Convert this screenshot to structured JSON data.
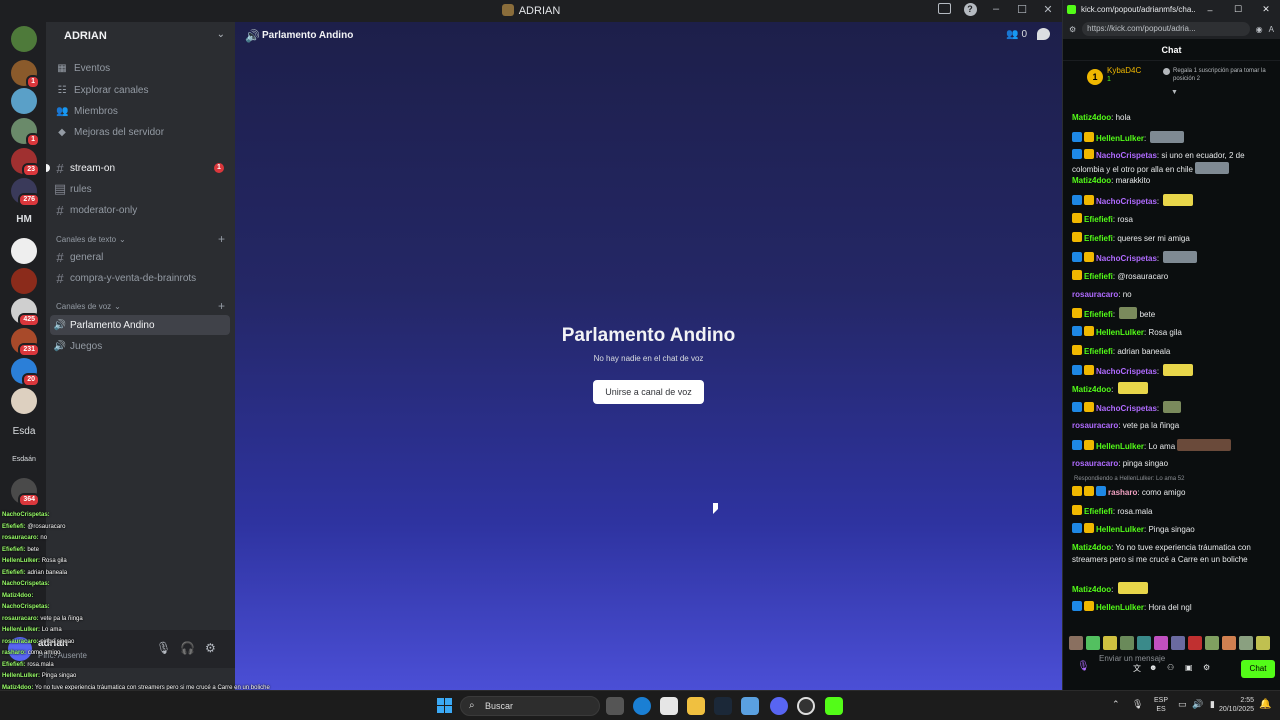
{
  "discord": {
    "window_title": "ADRIAN",
    "server_name": "ADRIAN",
    "server_menu": [
      {
        "icon": "calendar-icon",
        "label": "Eventos"
      },
      {
        "icon": "compass-icon",
        "label": "Explorar canales"
      },
      {
        "icon": "members-icon",
        "label": "Miembros"
      },
      {
        "icon": "boost-icon",
        "label": "Mejoras del servidor"
      }
    ],
    "channels_top": [
      {
        "label": "stream-on",
        "badge": "1"
      },
      {
        "label": "rules"
      },
      {
        "label": "moderator-only"
      }
    ],
    "text_category": "Canales de texto",
    "text_channels": [
      "general",
      "compra-y-venta-de-brainrots"
    ],
    "voice_category": "Canales de voz",
    "voice_channels": [
      "Parlamento Andino",
      "Juegos"
    ],
    "server_badges": [
      "1",
      "1",
      "23",
      "276",
      "425",
      "231",
      "20",
      "364"
    ],
    "server_labels": {
      "hm": "HM",
      "esda": "Esda",
      "esdaan": "Esdaán"
    },
    "user": {
      "name": "adrian",
      "status": "Pinc. Ausente"
    },
    "main": {
      "header_title": "Parlamento Andino",
      "member_count": "0",
      "vc_title": "Parlamento Andino",
      "vc_subtitle": "No hay nadie en el chat de voz",
      "join_button": "Unirse a canal de voz"
    }
  },
  "overlay_chat": [
    {
      "user": "NachoCrispetas:",
      "text": ""
    },
    {
      "user": "Efiefiefi:",
      "text": "@rosauracaro"
    },
    {
      "user": "rosauracaro:",
      "text": "no"
    },
    {
      "user": "Efiefiefi:",
      "text": "bete"
    },
    {
      "user": "HellenLulker:",
      "text": "Rosa gila"
    },
    {
      "user": "Efiefiefi:",
      "text": "adrian baneala"
    },
    {
      "user": "NachoCrispetas:",
      "text": ""
    },
    {
      "user": "Matiz4doo:",
      "text": ""
    },
    {
      "user": "NachoCrispetas:",
      "text": ""
    },
    {
      "user": "rosauracaro:",
      "text": "vete pa la ñinga"
    },
    {
      "user": "HellenLulker:",
      "text": "Lo ama"
    },
    {
      "user": "rosauracaro:",
      "text": "pinga singao"
    },
    {
      "user": "rasharo:",
      "text": "como amigo"
    },
    {
      "user": "Efiefiefi:",
      "text": "rosa.mala"
    },
    {
      "user": "HellenLulker:",
      "text": "Pinga singao"
    },
    {
      "user": "Matiz4doo:",
      "text": "Yo no tuve experiencia tráumatica con streamers pero si me crucé a Carre en un boliche"
    },
    {
      "user": "Matiz4doo:",
      "text": ""
    },
    {
      "user": "HellenLulker:",
      "text": "Hora del ngl"
    }
  ],
  "kick": {
    "tab_title": "kick.com/popout/adrianmfs/cha...",
    "url": "https://kick.com/popout/adria...",
    "chat_header": "Chat",
    "pinned": {
      "user": "KybaD4C",
      "count": "1",
      "note": "Regala 1 suscripción para tomar la posición 2"
    },
    "messages": [
      {
        "badges": [],
        "user": "Matiz4doo",
        "color": "#53fc18",
        "text": "hola",
        "emote": ""
      },
      {
        "badges": [
          "blue",
          "gold"
        ],
        "user": "HellenLulker",
        "color": "#53fc18",
        "text": "",
        "emote": "rock"
      },
      {
        "badges": [
          "blue",
          "gold"
        ],
        "user": "NachoCrispetas",
        "color": "#b06bff",
        "text": "si uno en ecuador, 2 de colombia y el otro por alla en chile",
        "emote": "rock"
      },
      {
        "badges": [],
        "user": "Matiz4doo",
        "color": "#53fc18",
        "text": "marakkito",
        "emote": ""
      },
      {
        "badges": [
          "blue",
          "gold"
        ],
        "user": "NachoCrispetas",
        "color": "#b06bff",
        "text": "",
        "emote": "wide"
      },
      {
        "badges": [
          "gold"
        ],
        "user": "Efiefiefi",
        "color": "#53fc18",
        "text": "rosa",
        "emote": ""
      },
      {
        "badges": [
          "gold"
        ],
        "user": "Efiefiefi",
        "color": "#53fc18",
        "text": "queres ser mi amiga",
        "emote": ""
      },
      {
        "badges": [
          "blue",
          "gold"
        ],
        "user": "NachoCrispetas",
        "color": "#b06bff",
        "text": "",
        "emote": "rock"
      },
      {
        "badges": [
          "gold"
        ],
        "user": "Efiefiefi",
        "color": "#53fc18",
        "text": "@rosauracaro",
        "emote": ""
      },
      {
        "badges": [],
        "user": "rosauracaro",
        "color": "#b06bff",
        "text": "no",
        "emote": ""
      },
      {
        "badges": [
          "gold"
        ],
        "user": "Efiefiefi",
        "color": "#53fc18",
        "text": "bete",
        "emote": "plain"
      },
      {
        "badges": [
          "blue",
          "gold"
        ],
        "user": "HellenLulker",
        "color": "#53fc18",
        "text": "Rosa gila",
        "emote": ""
      },
      {
        "badges": [
          "gold"
        ],
        "user": "Efiefiefi",
        "color": "#53fc18",
        "text": "adrian baneala",
        "emote": ""
      },
      {
        "badges": [
          "blue",
          "gold"
        ],
        "user": "NachoCrispetas",
        "color": "#b06bff",
        "text": "",
        "emote": "wide"
      },
      {
        "badges": [],
        "user": "Matiz4doo",
        "color": "#53fc18",
        "text": "",
        "emote": "wide"
      },
      {
        "badges": [
          "blue",
          "gold"
        ],
        "user": "NachoCrispetas",
        "color": "#b06bff",
        "text": "",
        "emote": "plain"
      },
      {
        "badges": [],
        "user": "rosauracaro",
        "color": "#b06bff",
        "text": "vete pa la ñinga",
        "emote": ""
      },
      {
        "badges": [
          "blue",
          "gold"
        ],
        "user": "HellenLulker",
        "color": "#53fc18",
        "text": "Lo ama",
        "emote": "face"
      },
      {
        "badges": [],
        "user": "rosauracaro",
        "color": "#b06bff",
        "text": "pinga singao",
        "emote": ""
      },
      {
        "badges": [
          "gold",
          "gold",
          "blue"
        ],
        "user": "rasharo",
        "color": "#f0a0c0",
        "text": "como amigo",
        "emote": ""
      },
      {
        "badges": [
          "gold"
        ],
        "user": "Efiefiefi",
        "color": "#53fc18",
        "text": "rosa.mala",
        "emote": ""
      },
      {
        "badges": [
          "blue",
          "gold"
        ],
        "user": "HellenLulker",
        "color": "#53fc18",
        "text": "Pinga singao",
        "emote": ""
      },
      {
        "badges": [],
        "user": "Matiz4doo",
        "color": "#53fc18",
        "text": "Yo no tuve experiencia tráumatica con streamers pero si me crucé a Carre en un boliche",
        "emote": ""
      },
      {
        "badges": [],
        "user": "Matiz4doo",
        "color": "#53fc18",
        "text": "",
        "emote": "wide"
      },
      {
        "badges": [
          "blue",
          "gold"
        ],
        "user": "HellenLulker",
        "color": "#53fc18",
        "text": "Hora del ngl",
        "emote": ""
      }
    ],
    "reply_context": "Respondiendo a HellenLulker: Lo ama 52",
    "input_placeholder": "Enviar un mensaje",
    "chat_button": "Chat"
  },
  "taskbar": {
    "search_placeholder": "Buscar",
    "lang_top": "ESP",
    "lang_bottom": "ES",
    "time": "2:55",
    "date": "20/10/2025"
  },
  "colors": {
    "kick_green": "#53fc18",
    "discord_blurple": "#5865f2",
    "badge_red": "#da373c"
  }
}
